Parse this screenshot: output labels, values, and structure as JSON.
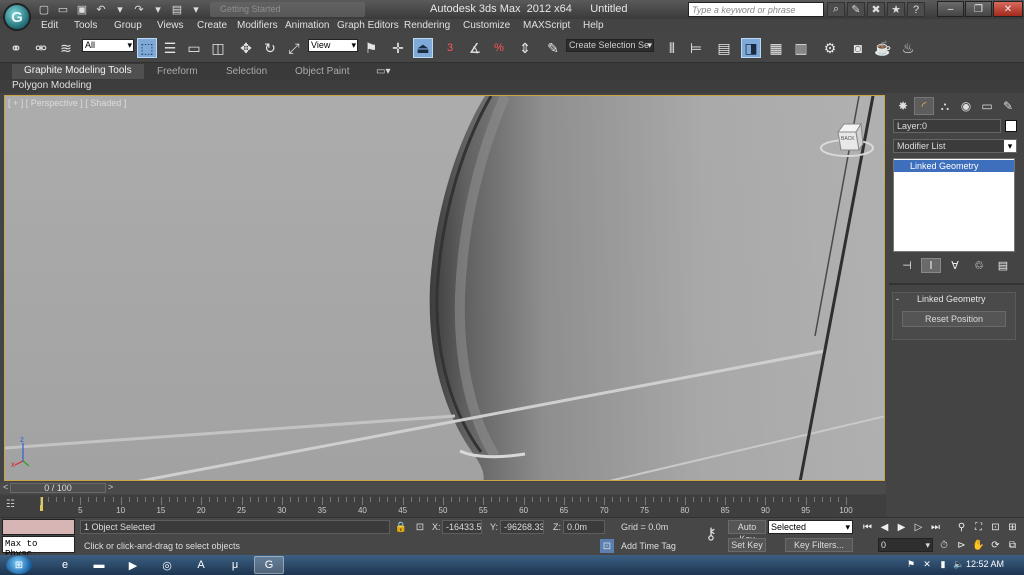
{
  "app": {
    "logo_letter": "G",
    "window_title": "Autodesk 3ds Max  2012 x64      Untitled",
    "faded_tab": "Getting Started",
    "search_placeholder": "Type a keyword or phrase"
  },
  "menu": [
    "Edit",
    "Tools",
    "Group",
    "Views",
    "Create",
    "Modifiers",
    "Animation",
    "Graph Editors",
    "Rendering",
    "Customize",
    "MAXScript",
    "Help"
  ],
  "toolbar": {
    "selection_filter": "All",
    "reference_coord": "View",
    "named_selection_placeholder": "Create Selection Se",
    "snap_labels": [
      "3",
      "%"
    ]
  },
  "ribbon": {
    "tabs": [
      "Graphite Modeling Tools",
      "Freeform",
      "Selection",
      "Object Paint"
    ],
    "panel_label": "Polygon Modeling"
  },
  "viewport": {
    "label": "[ + ] [ Perspective ] [ Shaded ]",
    "viewcube_face": "BACK",
    "axis_z": "z",
    "axis_x": "x"
  },
  "command_panel": {
    "layer_field": "Layer:0",
    "modifier_list": "Modifier List",
    "stack_items": [
      "Linked Geometry"
    ],
    "rollout_title": "Linked Geometry",
    "rollout_collapse": "-",
    "reset_button": "Reset Position"
  },
  "time": {
    "current_frame": "0 / 100",
    "ticks": [
      0,
      5,
      10,
      15,
      20,
      25,
      30,
      35,
      40,
      45,
      50,
      55,
      60,
      65,
      70,
      75,
      80,
      85,
      90,
      95,
      100
    ]
  },
  "status": {
    "listener_text": "Max to Physc.",
    "selection_info": "1 Object Selected",
    "prompt": "Click or click-and-drag to select objects",
    "x_label": "X:",
    "x_value": "-16433.58i",
    "y_label": "Y:",
    "y_value": "-96268.33i",
    "z_label": "Z:",
    "z_value": "0.0m",
    "grid": "Grid = 0.0m",
    "add_time_tag": "Add Time Tag",
    "auto_key": "Auto Key",
    "set_key": "Set Key",
    "key_mode": "Selected",
    "key_filters": "Key Filters...",
    "frame_value": "0"
  },
  "taskbar": {
    "clock": "12:52 AM"
  },
  "colors": {
    "viewport_bg": "#a9a9a9",
    "viewport_border": "#c8a54a",
    "stack_highlight": "#3e6fbd",
    "active_tool": "#7ea9d9"
  }
}
